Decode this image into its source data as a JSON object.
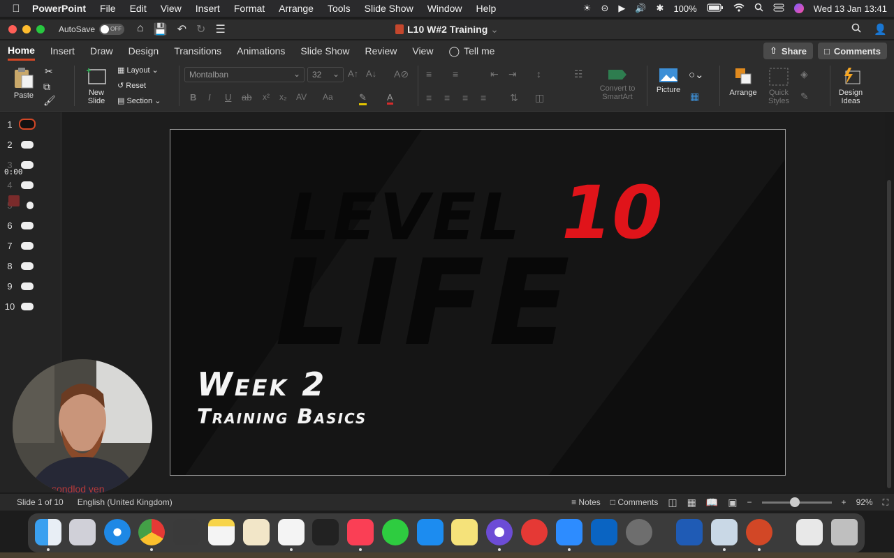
{
  "menubar": {
    "app_name": "PowerPoint",
    "items": [
      "File",
      "Edit",
      "View",
      "Insert",
      "Format",
      "Arrange",
      "Tools",
      "Slide Show",
      "Window",
      "Help"
    ],
    "battery": "100%",
    "datetime": "Wed 13 Jan  13:41"
  },
  "titlebar": {
    "autosave_label": "AutoSave",
    "autosave_state": "OFF",
    "doc_title": "L10 W#2 Training"
  },
  "tabs": {
    "items": [
      "Home",
      "Insert",
      "Draw",
      "Design",
      "Transitions",
      "Animations",
      "Slide Show",
      "Review",
      "View"
    ],
    "tell_me": "Tell me",
    "share": "Share",
    "comments": "Comments"
  },
  "ribbon": {
    "paste": "Paste",
    "new_slide_1": "New",
    "new_slide_2": "Slide",
    "layout": "Layout",
    "reset": "Reset",
    "section": "Section",
    "font_name": "Montalban",
    "font_size": "32",
    "convert_1": "Convert to",
    "convert_2": "SmartArt",
    "picture": "Picture",
    "arrange": "Arrange",
    "quick_1": "Quick",
    "quick_2": "Styles",
    "design_1": "Design",
    "design_2": "Ideas"
  },
  "slides_panel": {
    "numbers": [
      "1",
      "2",
      "3",
      "4",
      "5",
      "6",
      "7",
      "8",
      "9",
      "10"
    ],
    "timer": "0:00"
  },
  "slide": {
    "logo_word_1": "LEVEL",
    "logo_number": "10",
    "logo_word_2": "LIFE",
    "title": "Week 2",
    "subtitle": "Training Basics",
    "accent_color": "#e0141a"
  },
  "webcam": {
    "shirt_text": "sondlod ven"
  },
  "statusbar": {
    "slide_info": "Slide 1 of 10",
    "language": "English (United Kingdom)",
    "notes": "Notes",
    "comments": "Comments",
    "zoom": "92%"
  }
}
